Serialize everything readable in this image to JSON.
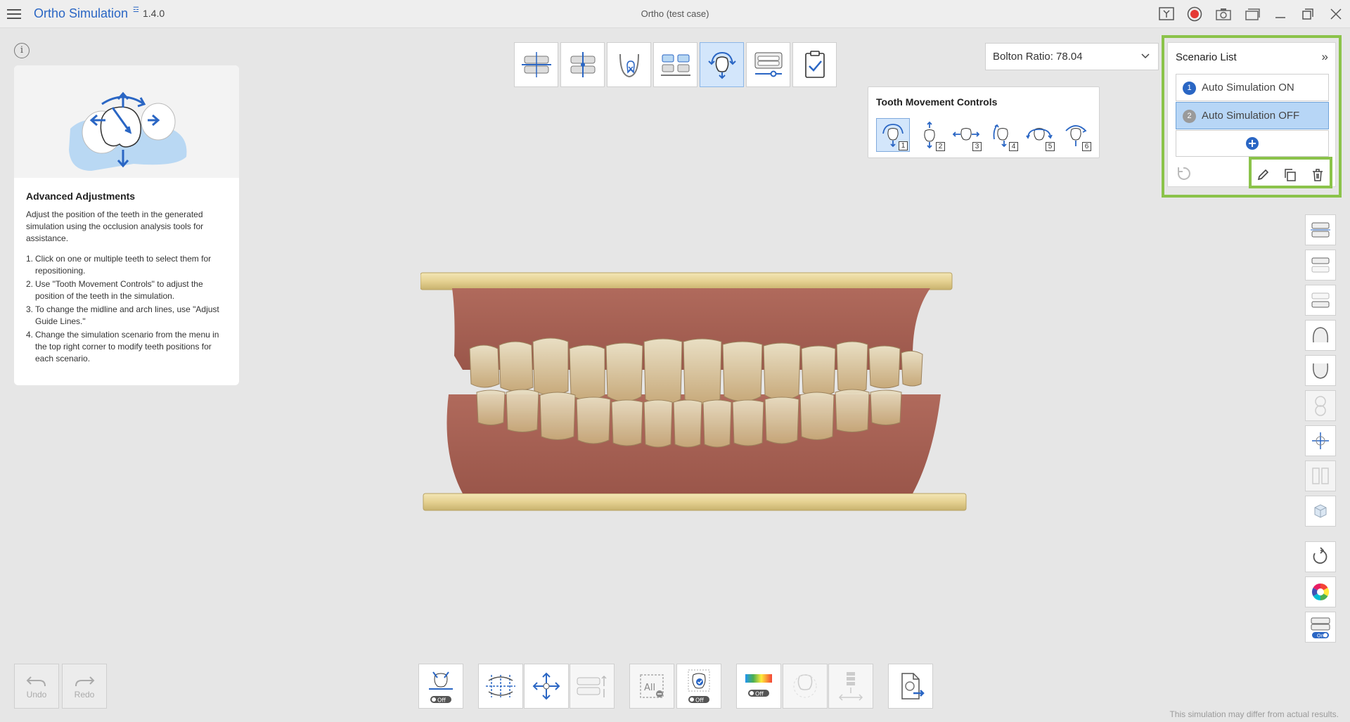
{
  "app": {
    "title": "Ortho Simulation",
    "badge": "☲",
    "version": "1.4.0",
    "case_title": "Ortho (test case)"
  },
  "guide": {
    "title": "Advanced Adjustments",
    "description": "Adjust the position of the teeth in the generated simulation using the occlusion analysis tools for assistance.",
    "steps": [
      {
        "num": "1.",
        "text": "Click on one or multiple teeth to select them for repositioning."
      },
      {
        "num": "2.",
        "text": "Use \"Tooth Movement Controls\" to adjust the position of the teeth in the simulation."
      },
      {
        "num": "3.",
        "text": "To change the midline and arch lines, use \"Adjust Guide Lines.\""
      },
      {
        "num": "4.",
        "text": "Change the simulation scenario from the menu in the top right corner to modify teeth positions for each scenario."
      }
    ]
  },
  "bolton": {
    "label": "Bolton Ratio: 78.04"
  },
  "tooth_movement": {
    "title": "Tooth Movement Controls",
    "buttons": [
      "1",
      "2",
      "3",
      "4",
      "5",
      "6"
    ]
  },
  "scenario_list": {
    "title": "Scenario List",
    "collapse_glyph": "»",
    "items": [
      {
        "num": "1",
        "label": "Auto Simulation ON"
      },
      {
        "num": "2",
        "label": "Auto Simulation OFF"
      }
    ]
  },
  "bottom": {
    "undo": "Undo",
    "redo": "Redo",
    "off_label": "Off",
    "on_label": "On",
    "all_label": "All"
  },
  "disclaimer": "This simulation may differ from actual results.",
  "colors": {
    "accent": "#2a66c4",
    "highlight": "#8bc34a",
    "selected": "#b7d6f6",
    "record": "#e53935"
  }
}
